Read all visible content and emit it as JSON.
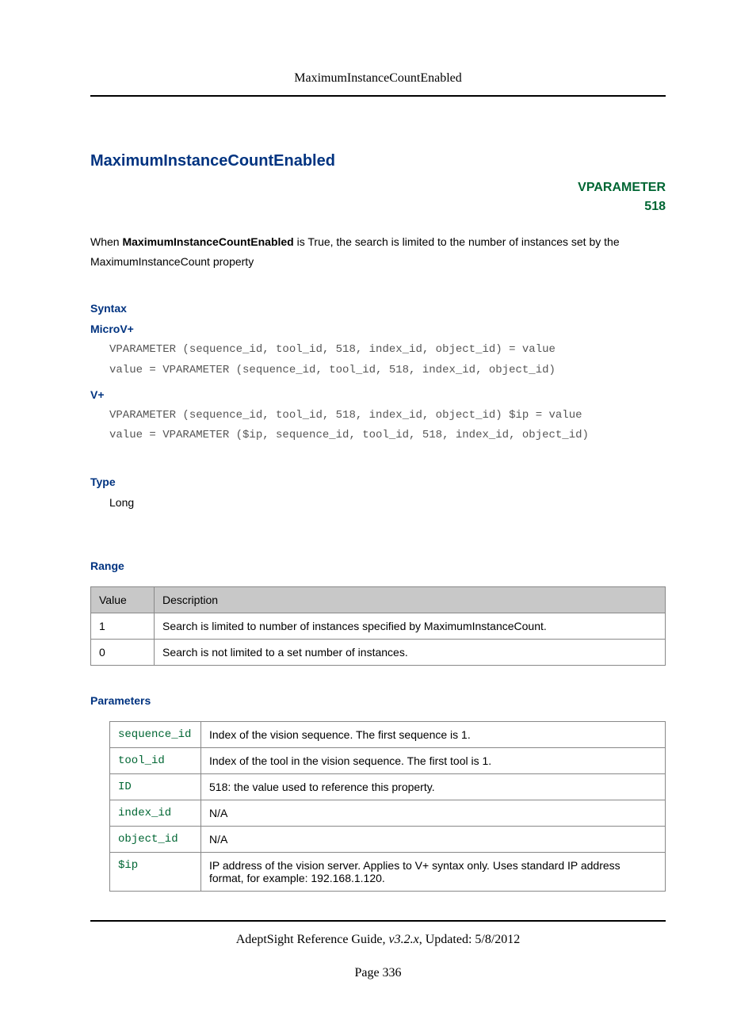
{
  "header": {
    "title": "MaximumInstanceCountEnabled"
  },
  "main": {
    "heading": "MaximumInstanceCountEnabled",
    "vparam_label": "VPARAMETER",
    "vparam_num": "518",
    "intro_pre": "When ",
    "intro_bold": "MaximumInstanceCountEnabled",
    "intro_post": " is True, the search is limited to the number of instances set by the MaximumInstanceCount property"
  },
  "syntax": {
    "label": "Syntax",
    "microv_label": "MicroV+",
    "microv_code": "VPARAMETER (sequence_id, tool_id, 518, index_id, object_id) = value\nvalue = VPARAMETER (sequence_id, tool_id, 518, index_id, object_id)",
    "vplus_label": "V+",
    "vplus_code": "VPARAMETER (sequence_id, tool_id, 518, index_id, object_id) $ip = value\nvalue = VPARAMETER ($ip, sequence_id, tool_id, 518, index_id, object_id)"
  },
  "type": {
    "label": "Type",
    "value": "Long"
  },
  "range": {
    "label": "Range",
    "headers": [
      "Value",
      "Description"
    ],
    "rows": [
      {
        "value": "1",
        "desc": "Search is limited to number of instances specified by MaximumInstanceCount."
      },
      {
        "value": "0",
        "desc": "Search is not limited to a set number of instances."
      }
    ]
  },
  "parameters": {
    "label": "Parameters",
    "rows": [
      {
        "name": "sequence_id",
        "desc": "Index of the vision sequence. The first sequence is 1."
      },
      {
        "name": "tool_id",
        "desc": "Index of the tool in the vision sequence. The first tool is 1."
      },
      {
        "name": "ID",
        "desc": "518: the value used to reference this property."
      },
      {
        "name": "index_id",
        "desc": "N/A"
      },
      {
        "name": "object_id",
        "desc": "N/A"
      },
      {
        "name": "$ip",
        "desc": "IP address of the vision server. Applies to V+ syntax only. Uses standard IP address format, for example: 192.168.1.120."
      }
    ]
  },
  "footer": {
    "guide": "AdeptSight Reference Guide",
    "sep": ", ",
    "version": "v3.2.x",
    "updated": ", Updated: 5/8/2012",
    "page": "Page 336"
  }
}
